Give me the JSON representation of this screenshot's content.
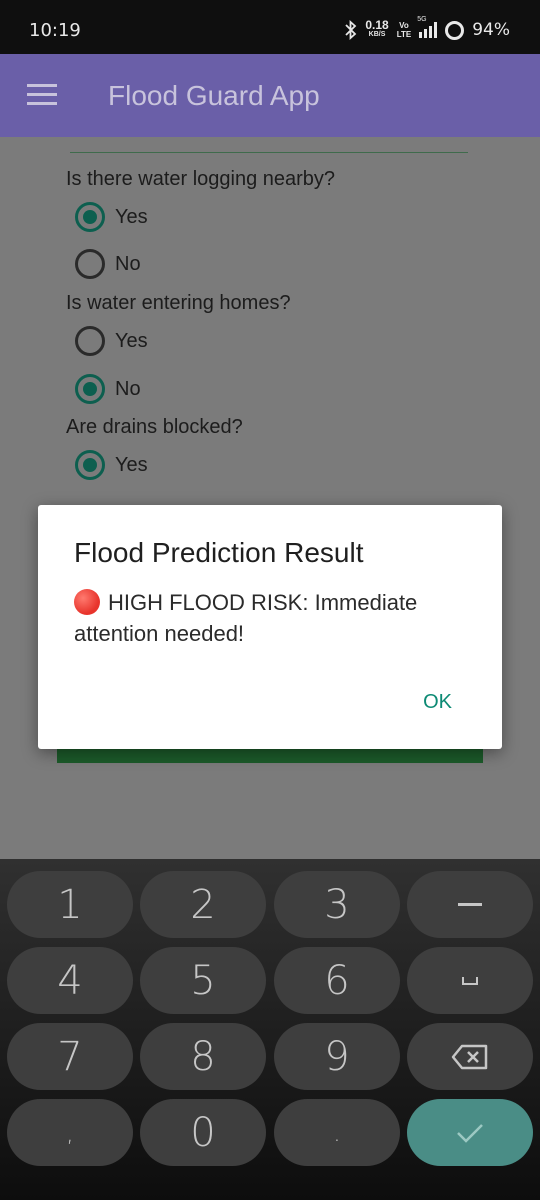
{
  "status_bar": {
    "time": "10:19",
    "net_speed": "0.18",
    "net_unit": "KB/S",
    "volte_top": "Vo",
    "volte_bottom": "LTE",
    "network": "5G",
    "battery": "94%"
  },
  "app": {
    "title": "Flood Guard App",
    "questions": [
      {
        "text": "Is there water logging nearby?",
        "options": [
          {
            "label": "Yes",
            "checked": true
          },
          {
            "label": "No",
            "checked": false
          }
        ]
      },
      {
        "text": "Is water entering homes?",
        "options": [
          {
            "label": "Yes",
            "checked": false
          },
          {
            "label": "No",
            "checked": true
          }
        ]
      },
      {
        "text": "Are drains blocked?",
        "options": [
          {
            "label": "Yes",
            "checked": true
          }
        ]
      }
    ]
  },
  "dialog": {
    "title": "Flood Prediction Result",
    "message": "HIGH FLOOD RISK: Immediate attention needed!",
    "ok_label": "OK"
  },
  "keyboard": {
    "keys": [
      "1",
      "2",
      "3",
      "4",
      "5",
      "6",
      "7",
      "8",
      "9",
      ",",
      "0",
      "."
    ]
  },
  "colors": {
    "appbar": "#6a5fa8",
    "radio_checked": "#0d5f4f",
    "accent_teal": "#0d8a74",
    "enter_key": "#4a8d86"
  }
}
